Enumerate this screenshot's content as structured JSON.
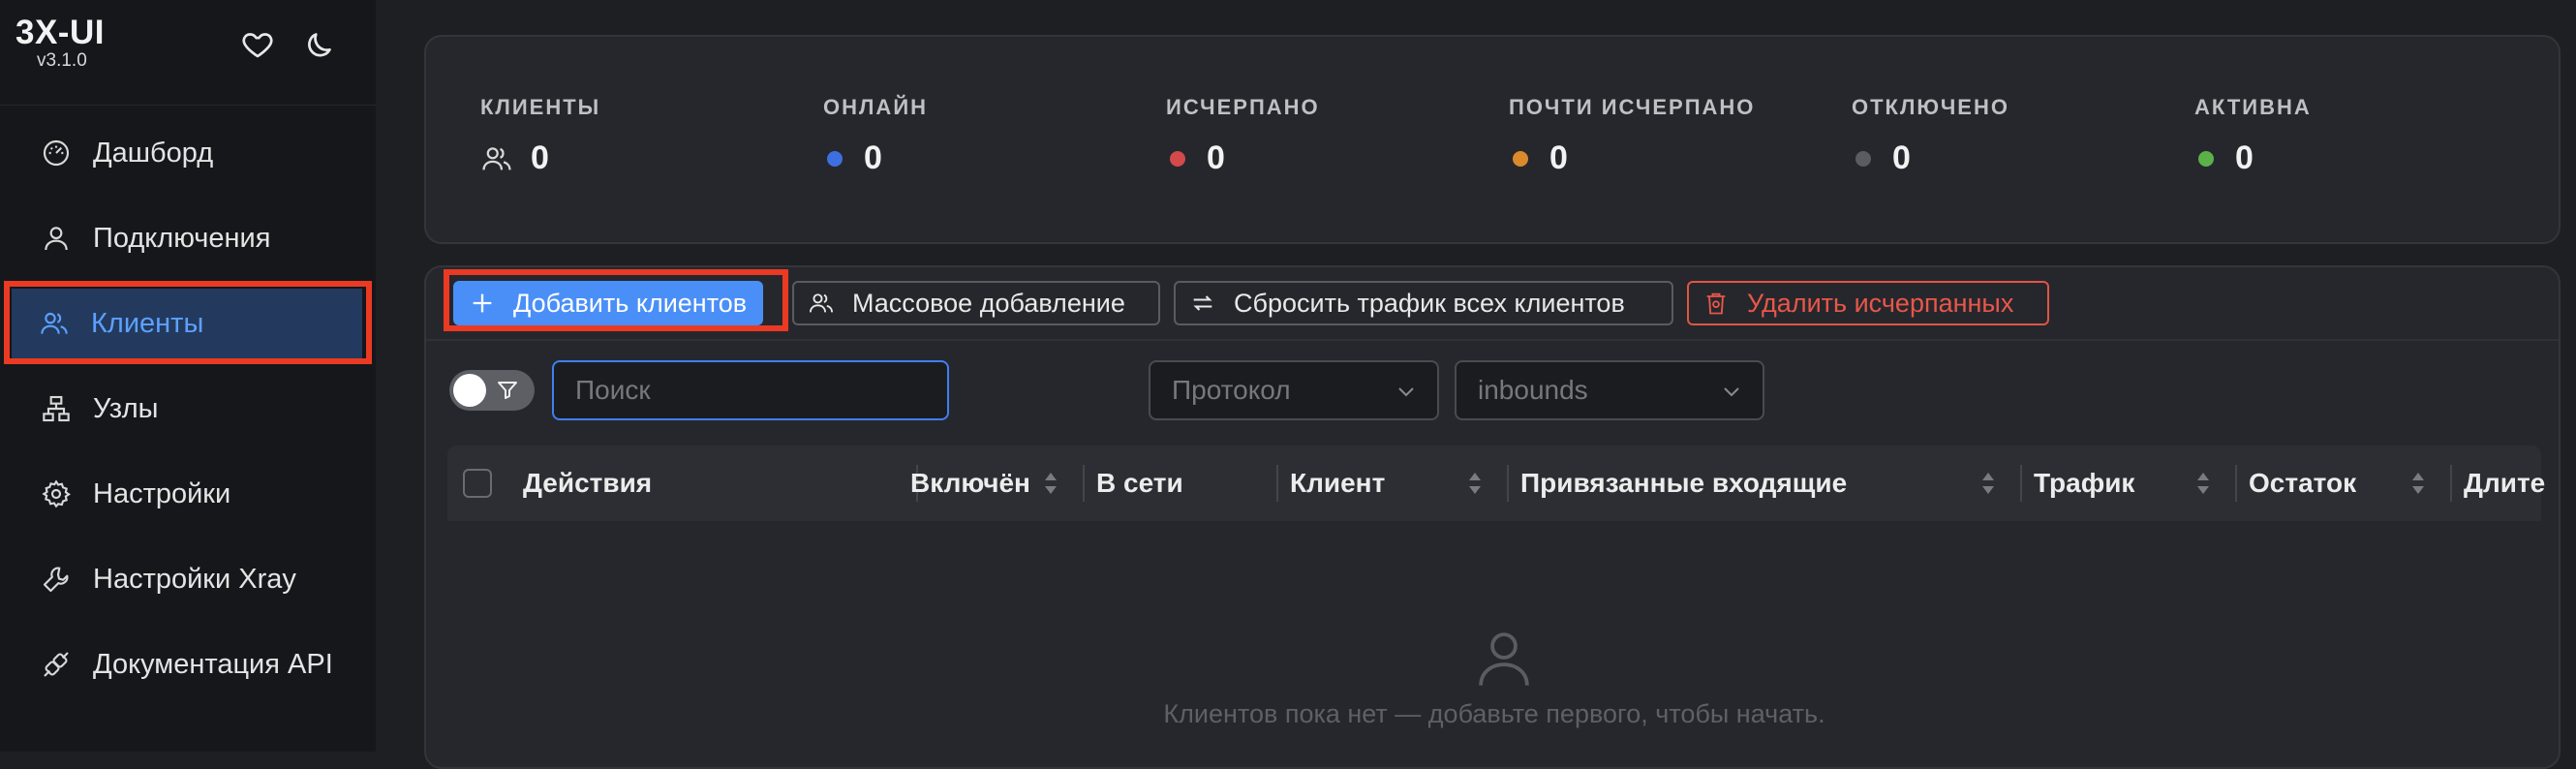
{
  "brand": {
    "title": "3X-UI",
    "version": "v3.1.0"
  },
  "sidebar": {
    "items": [
      {
        "label": "Дашборд",
        "icon": "dashboard-icon"
      },
      {
        "label": "Подключения",
        "icon": "user-icon"
      },
      {
        "label": "Клиенты",
        "icon": "users-icon",
        "active": true
      },
      {
        "label": "Узлы",
        "icon": "cluster-icon"
      },
      {
        "label": "Настройки",
        "icon": "gear-icon"
      },
      {
        "label": "Настройки Xray",
        "icon": "tool-icon"
      },
      {
        "label": "Документация API",
        "icon": "api-icon"
      }
    ]
  },
  "stats": [
    {
      "label": "КЛИЕНТЫ",
      "value": "0",
      "icon": "users-icon"
    },
    {
      "label": "ОНЛАЙН",
      "value": "0",
      "color": "#3d6fe0"
    },
    {
      "label": "ИСЧЕРПАНО",
      "value": "0",
      "color": "#d24a4a"
    },
    {
      "label": "ПОЧТИ ИСЧЕРПАНО",
      "value": "0",
      "color": "#d98a2b"
    },
    {
      "label": "ОТКЛЮЧЕНО",
      "value": "0",
      "color": "#5b5c61"
    },
    {
      "label": "АКТИВНА",
      "value": "0",
      "color": "#5bb04a"
    }
  ],
  "toolbar": {
    "add_clients": "Добавить клиентов",
    "bulk_add": "Массовое добавление",
    "reset_traffic": "Сбросить трафик всех клиентов",
    "delete_depleted": "Удалить исчерпанных"
  },
  "filters": {
    "search_placeholder": "Поиск",
    "protocol_placeholder": "Протокол",
    "inbounds_placeholder": "inbounds"
  },
  "table": {
    "columns": [
      "Действия",
      "Включён",
      "В сети",
      "Клиент",
      "Привязанные входящие",
      "Трафик",
      "Остаток",
      "Длите"
    ],
    "empty_text": "Клиентов пока нет — добавьте первого, чтобы начать."
  },
  "colors": {
    "accent": "#4a8ff7",
    "danger": "#e8574a",
    "highlight": "#ea3a23"
  }
}
